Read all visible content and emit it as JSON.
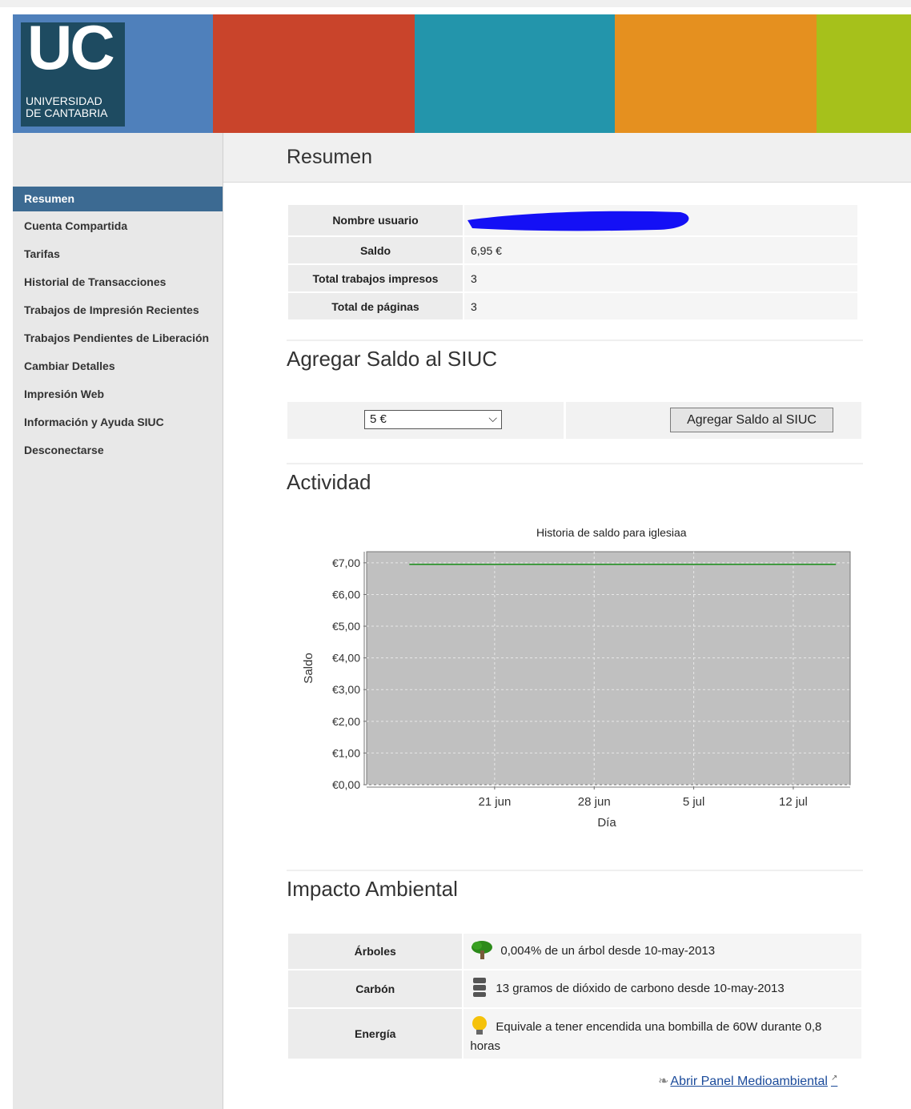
{
  "colors": {
    "banner_blue": "#4f80bb",
    "banner_red": "#c9442b",
    "banner_teal": "#2395ab",
    "banner_orange": "#e5901f",
    "banner_green": "#a6c11b",
    "logo_bg": "#1e4b61",
    "active_nav": "#3c6a92",
    "line_green": "#0a8a0a",
    "plot_bg": "#c0c0c0"
  },
  "logo": {
    "mark": "UC",
    "line1": "UNIVERSIDAD",
    "line2": "DE CANTABRIA"
  },
  "page_title": "Resumen",
  "nav": [
    {
      "label": "Resumen",
      "active": true
    },
    {
      "label": "Cuenta Compartida"
    },
    {
      "label": "Tarifas"
    },
    {
      "label": "Historial de Transacciones"
    },
    {
      "label": "Trabajos de Impresión Recientes"
    },
    {
      "label": "Trabajos Pendientes de Liberación"
    },
    {
      "label": "Cambiar Detalles"
    },
    {
      "label": "Impresión Web"
    },
    {
      "label": "Información y Ayuda SIUC"
    },
    {
      "label": "Desconectarse"
    }
  ],
  "summary": {
    "rows": [
      {
        "label": "Nombre usuario",
        "value": ""
      },
      {
        "label": "Saldo",
        "value": "6,95 €"
      },
      {
        "label": "Total trabajos impresos",
        "value": "3"
      },
      {
        "label": "Total de páginas",
        "value": "3"
      }
    ]
  },
  "add_balance": {
    "heading": "Agregar Saldo al SIUC",
    "selected": "5 €",
    "button": "Agregar Saldo al SIUC"
  },
  "activity": {
    "heading": "Actividad"
  },
  "chart_data": {
    "type": "line",
    "title": "Historia de saldo para iglesiaa",
    "xlabel": "Día",
    "ylabel": "Saldo",
    "ylim": [
      0,
      7.35
    ],
    "y_ticks": [
      "€0,00",
      "€1,00",
      "€2,00",
      "€3,00",
      "€4,00",
      "€5,00",
      "€6,00",
      "€7,00"
    ],
    "x_ticks": [
      "21 jun",
      "28 jun",
      "5 jul",
      "12 jul"
    ],
    "series": [
      {
        "x": [
          "2013-06-15",
          "2013-07-15"
        ],
        "values": [
          6.95,
          6.95
        ]
      }
    ],
    "grid": true
  },
  "environment": {
    "heading": "Impacto Ambiental",
    "rows": [
      {
        "label": "Árboles",
        "value": "0,004% de un árbol desde 10-may-2013",
        "icon": "tree-icon"
      },
      {
        "label": "Carbón",
        "value": "13 gramos de dióxido de carbono desde 10-may-2013",
        "icon": "carbon-icon"
      },
      {
        "label": "Energía",
        "value": "Equivale a tener encendida una bombilla de 60W durante 0,8 horas",
        "icon": "bulb-icon"
      }
    ],
    "link": "Abrir Panel Medioambiental"
  }
}
